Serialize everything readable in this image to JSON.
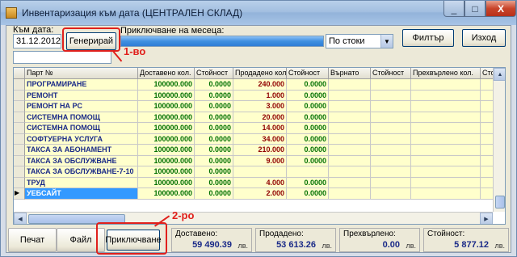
{
  "window": {
    "title": "Инвентаризация към дата (ЦЕНТРАЛЕН СКЛАД)",
    "minimize": "_",
    "maximize": "□",
    "close": "X"
  },
  "toolbar": {
    "date_label": "Към дата:",
    "date_value": "31.12.2012",
    "generate_label": "Генерирай",
    "closing_label": "Приключване на месеца:",
    "progress_fraction": 1.0,
    "group_select": "По стоки",
    "filter_label": "Филтър",
    "exit_label": "Изход",
    "filter_input_value": ""
  },
  "grid": {
    "columns": [
      "Парт №",
      "Доставено кол.",
      "Стойност",
      "Продадено кол.",
      "Стойност",
      "Върнато",
      "Стойност",
      "Прехвърлено кол.",
      "Стойност"
    ],
    "rows": [
      {
        "name": "ПРОГРАМИРАНЕ",
        "delivered": "100000.000",
        "dval": "0.0000",
        "sold": "240.000",
        "sval": "0.0000",
        "selected": false
      },
      {
        "name": "РЕМОНТ",
        "delivered": "100000.000",
        "dval": "0.0000",
        "sold": "1.000",
        "sval": "0.0000",
        "selected": false
      },
      {
        "name": "РЕМОНТ НА PC",
        "delivered": "100000.000",
        "dval": "0.0000",
        "sold": "3.000",
        "sval": "0.0000",
        "selected": false
      },
      {
        "name": "СИСТЕМНА ПОМОЩ",
        "delivered": "100000.000",
        "dval": "0.0000",
        "sold": "20.000",
        "sval": "0.0000",
        "selected": false
      },
      {
        "name": "СИСТЕМНА ПОМОЩ",
        "delivered": "100000.000",
        "dval": "0.0000",
        "sold": "14.000",
        "sval": "0.0000",
        "selected": false
      },
      {
        "name": "СОФТУЕРНА УСЛУГА",
        "delivered": "100000.000",
        "dval": "0.0000",
        "sold": "34.000",
        "sval": "0.0000",
        "selected": false
      },
      {
        "name": "ТАКСА ЗА АБОНАМЕНТ",
        "delivered": "100000.000",
        "dval": "0.0000",
        "sold": "210.000",
        "sval": "0.0000",
        "selected": false
      },
      {
        "name": "ТАКСА ЗА ОБСЛУЖВАНЕ",
        "delivered": "100000.000",
        "dval": "0.0000",
        "sold": "9.000",
        "sval": "0.0000",
        "selected": false
      },
      {
        "name": "ТАКСА ЗА ОБСЛУЖВАНЕ-7-10",
        "delivered": "100000.000",
        "dval": "0.0000",
        "sold": "",
        "sval": "",
        "selected": false
      },
      {
        "name": "ТРУД",
        "delivered": "100000.000",
        "dval": "0.0000",
        "sold": "4.000",
        "sval": "0.0000",
        "selected": false
      },
      {
        "name": "УЕБСАЙТ",
        "delivered": "100000.000",
        "dval": "0.0000",
        "sold": "2.000",
        "sval": "0.0000",
        "selected": true
      }
    ]
  },
  "bottom": {
    "print_label": "Печат",
    "file_label": "Файл",
    "close_label": "Приключване",
    "delivered_label": "Доставено:",
    "delivered_value": "59 490.39",
    "sold_label": "Продадено:",
    "sold_value": "53 613.26",
    "transferred_label": "Прехвърлено:",
    "transferred_value": "0.00",
    "value_label": "Стойност:",
    "value_value": "5 877.12",
    "unit": "лв."
  },
  "annotations": {
    "first": "1-во",
    "second": "2-ро",
    "color": "#e0201c"
  },
  "colors": {
    "row_bg": "#ffffcc",
    "name_text": "#1a2a88",
    "green_text": "#007000",
    "sold_text": "#900000",
    "selection": "#3399ff"
  }
}
